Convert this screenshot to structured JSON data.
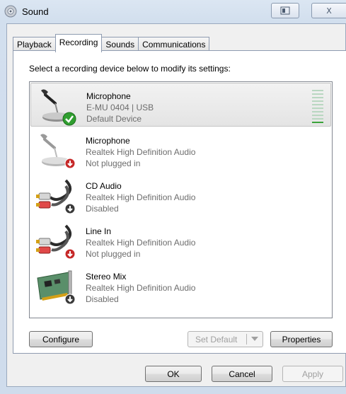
{
  "window": {
    "title": "Sound",
    "icon": "speaker-icon",
    "help_button_icon": "help-window-icon",
    "close_label": "X"
  },
  "tabs": [
    {
      "label": "Playback",
      "active": false
    },
    {
      "label": "Recording",
      "active": true
    },
    {
      "label": "Sounds",
      "active": false
    },
    {
      "label": "Communications",
      "active": false
    }
  ],
  "instructions": "Select a recording device below to modify its settings:",
  "devices": [
    {
      "name": "Microphone",
      "driver": "E-MU 0404 | USB",
      "status": "Default Device",
      "icon": "microphone-icon",
      "badge": "green-check-icon",
      "selected": true
    },
    {
      "name": "Microphone",
      "driver": "Realtek High Definition Audio",
      "status": "Not plugged in",
      "icon": "microphone-icon",
      "badge": "red-down-arrow-icon",
      "selected": false
    },
    {
      "name": "CD Audio",
      "driver": "Realtek High Definition Audio",
      "status": "Disabled",
      "icon": "rca-cable-icon",
      "badge": "gray-down-arrow-icon",
      "selected": false
    },
    {
      "name": "Line In",
      "driver": "Realtek High Definition Audio",
      "status": "Not plugged in",
      "icon": "rca-cable-icon",
      "badge": "red-down-arrow-icon",
      "selected": false
    },
    {
      "name": "Stereo Mix",
      "driver": "Realtek High Definition Audio",
      "status": "Disabled",
      "icon": "sound-card-icon",
      "badge": "gray-down-arrow-icon",
      "selected": false
    }
  ],
  "level_meter": {
    "level": 0.1,
    "segments": 10,
    "active_color": "#3aa33a",
    "inactive_color": "#b9d7c1"
  },
  "buttons": {
    "configure": "Configure",
    "set_default": "Set Default",
    "properties": "Properties",
    "ok": "OK",
    "cancel": "Cancel",
    "apply": "Apply"
  }
}
